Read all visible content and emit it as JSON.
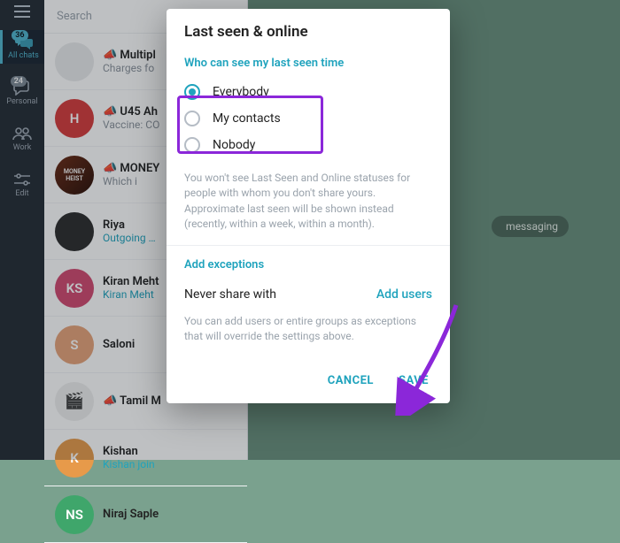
{
  "rail": {
    "tabs": [
      {
        "label": "All chats",
        "badge": "36"
      },
      {
        "label": "Personal",
        "badge": "24"
      },
      {
        "label": "Work"
      },
      {
        "label": "Edit"
      }
    ]
  },
  "search": {
    "placeholder": "Search"
  },
  "chats": [
    {
      "avatar_bg": "#e9eaec",
      "avatar_txt": "",
      "title": "📣 Multipl",
      "sub": "Charges fo",
      "accent": false
    },
    {
      "avatar_bg": "#d63b3b",
      "avatar_txt": "H",
      "title": "📣 U45 Ah",
      "sub": "Vaccine: CO",
      "accent": false
    },
    {
      "avatar_bg": "#2a2220",
      "avatar_txt": "",
      "title": "📣 MONEY",
      "sub": "Which i",
      "accent": false,
      "mh": true
    },
    {
      "avatar_bg": "#2b2b2b",
      "avatar_txt": "",
      "title": "Riya",
      "sub": "Outgoing …",
      "accent": true
    },
    {
      "avatar_bg": "#d1486f",
      "avatar_txt": "KS",
      "title": "Kiran Meht",
      "sub": "Kiran Meht",
      "accent": true
    },
    {
      "avatar_bg": "#e7a379",
      "avatar_txt": "S",
      "title": "Saloni",
      "sub": "",
      "accent": false
    },
    {
      "avatar_bg": "#efefef",
      "avatar_txt": "",
      "title": "📣 Tamil M",
      "sub": "",
      "accent": false,
      "tm": true
    },
    {
      "avatar_bg": "#e79a4a",
      "avatar_txt": "K",
      "title": "Kishan",
      "sub": "Kishan join",
      "accent": true
    },
    {
      "avatar_bg": "#3fa66b",
      "avatar_txt": "NS",
      "title": "Niraj Saple",
      "sub": "",
      "accent": false
    }
  ],
  "main": {
    "hint": "messaging"
  },
  "modal": {
    "title": "Last seen & online",
    "section_label": "Who can see my last seen time",
    "options": [
      "Everybody",
      "My contacts",
      "Nobody"
    ],
    "selected": 0,
    "info": "You won't see Last Seen and Online statuses for people with whom you don't share yours. Approximate last seen will be shown instead (recently, within a week, within a month).",
    "exceptions_label": "Add exceptions",
    "never_share_label": "Never share with",
    "add_users_label": "Add users",
    "exceptions_info": "You can add users or entire groups as exceptions that will override the settings above.",
    "cancel": "CANCEL",
    "save": "SAVE"
  }
}
